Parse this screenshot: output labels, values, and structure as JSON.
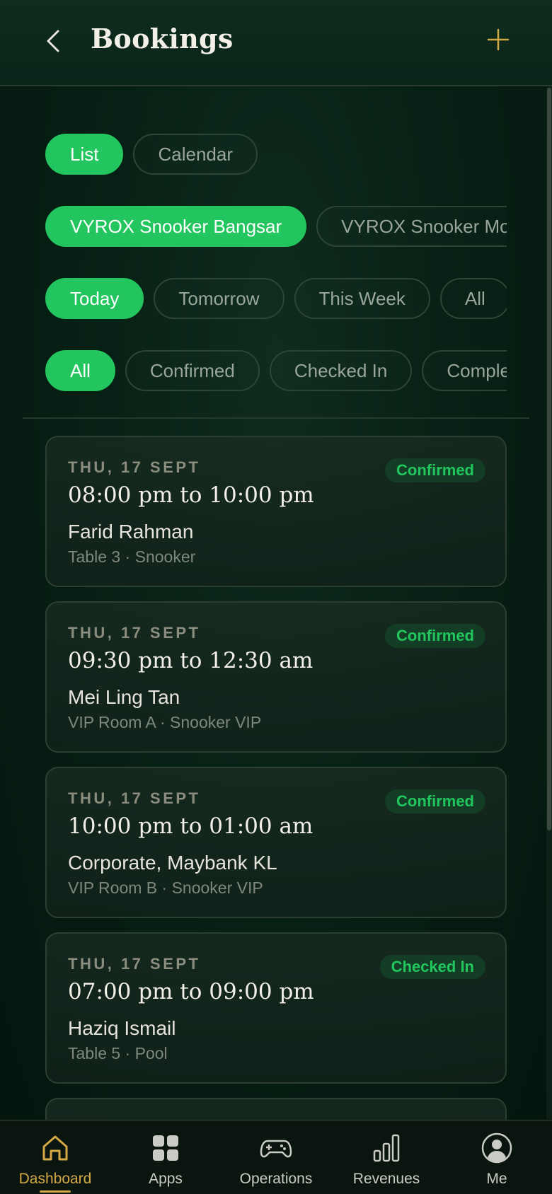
{
  "header": {
    "title": "Bookings",
    "back_icon": "chevron-left-icon",
    "add_icon": "plus-icon"
  },
  "view_toggle": [
    {
      "label": "List",
      "active": true
    },
    {
      "label": "Calendar",
      "active": false
    }
  ],
  "venues": [
    {
      "label": "VYROX Snooker Bangsar",
      "active": true
    },
    {
      "label": "VYROX Snooker Mont Kiara",
      "active": false
    }
  ],
  "date_filters": [
    {
      "label": "Today",
      "active": true
    },
    {
      "label": "Tomorrow",
      "active": false
    },
    {
      "label": "This Week",
      "active": false
    },
    {
      "label": "All",
      "active": false
    }
  ],
  "status_filters": [
    {
      "label": "All",
      "active": true
    },
    {
      "label": "Confirmed",
      "active": false
    },
    {
      "label": "Checked In",
      "active": false
    },
    {
      "label": "Completed",
      "active": false
    }
  ],
  "bookings": [
    {
      "date": "THU, 17 SEPT",
      "time": "08:00 pm to 10:00 pm",
      "name": "Farid Rahman",
      "detail": "Table 3 · Snooker",
      "status": "Confirmed"
    },
    {
      "date": "THU, 17 SEPT",
      "time": "09:30 pm to 12:30 am",
      "name": "Mei Ling Tan",
      "detail": "VIP Room A · Snooker VIP",
      "status": "Confirmed"
    },
    {
      "date": "THU, 17 SEPT",
      "time": "10:00 pm to 01:00 am",
      "name": "Corporate, Maybank KL",
      "detail": "VIP Room B · Snooker VIP",
      "status": "Confirmed"
    },
    {
      "date": "THU, 17 SEPT",
      "time": "07:00 pm to 09:00 pm",
      "name": "Haziq Ismail",
      "detail": "Table 5 · Pool",
      "status": "Checked In"
    },
    {
      "date": "",
      "time": "",
      "name": "",
      "detail": "",
      "status": ""
    }
  ],
  "nav": [
    {
      "label": "Dashboard",
      "icon": "home-icon",
      "active": true
    },
    {
      "label": "Apps",
      "icon": "apps-grid-icon",
      "active": false
    },
    {
      "label": "Operations",
      "icon": "gamepad-icon",
      "active": false
    },
    {
      "label": "Revenues",
      "icon": "bar-chart-icon",
      "active": false
    },
    {
      "label": "Me",
      "icon": "user-circle-icon",
      "active": false
    }
  ],
  "colors": {
    "accent": "#22c55e",
    "gold": "#d4a945",
    "background": "#072015",
    "badge_bg": "#133d25"
  }
}
